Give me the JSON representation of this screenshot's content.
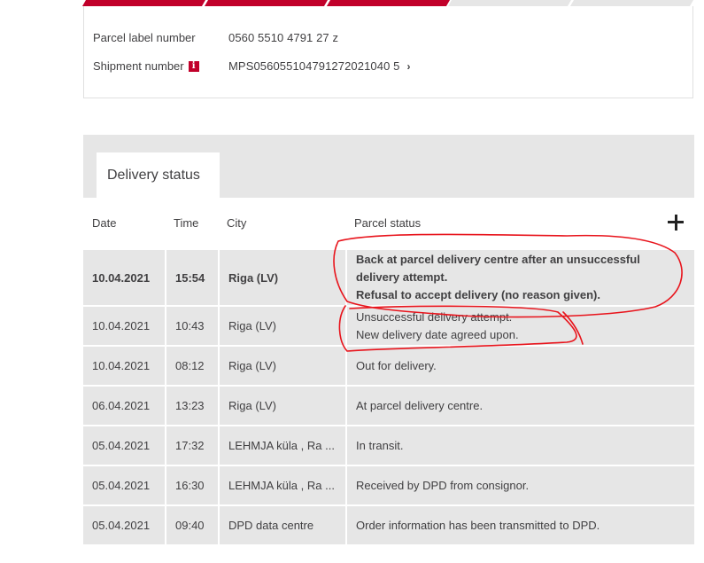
{
  "progress": {
    "segments_done": 3,
    "segments_total": 5,
    "accent": "#c1002a"
  },
  "parcel": {
    "label_number_label": "Parcel label number",
    "label_number_value": "0560 5510 4791 27 z",
    "shipment_label": "Shipment number",
    "shipment_value": "MPS056055104791272021040 5",
    "info_icon": "info-icon",
    "chevron_icon": "chevron-right-icon"
  },
  "delivery": {
    "tab_label": "Delivery status",
    "columns": {
      "date": "Date",
      "time": "Time",
      "city": "City",
      "status": "Parcel status"
    },
    "expand_icon": "plus-icon",
    "rows": [
      {
        "date": "10.04.2021",
        "time": "15:54",
        "city": "Riga (LV)",
        "status_lines": [
          "Back at parcel delivery centre after an unsuccessful",
          "delivery attempt.",
          "Refusal to accept delivery (no reason given)."
        ]
      },
      {
        "date": "10.04.2021",
        "time": "10:43",
        "city": "Riga (LV)",
        "status_lines": [
          "Unsuccessful delivery attempt.",
          "New delivery date agreed upon."
        ]
      },
      {
        "date": "10.04.2021",
        "time": "08:12",
        "city": "Riga (LV)",
        "status_lines": [
          "Out for delivery."
        ]
      },
      {
        "date": "06.04.2021",
        "time": "13:23",
        "city": "Riga (LV)",
        "status_lines": [
          "At parcel delivery centre."
        ]
      },
      {
        "date": "05.04.2021",
        "time": "17:32",
        "city": "LEHMJA küla , Ra ...",
        "status_lines": [
          "In transit."
        ]
      },
      {
        "date": "05.04.2021",
        "time": "16:30",
        "city": "LEHMJA küla , Ra ...",
        "status_lines": [
          "Received by DPD from consignor."
        ]
      },
      {
        "date": "05.04.2021",
        "time": "09:40",
        "city": "DPD data centre",
        "status_lines": [
          "Order information has been transmitted to DPD."
        ]
      }
    ]
  },
  "annotation_color": "#e8141c"
}
